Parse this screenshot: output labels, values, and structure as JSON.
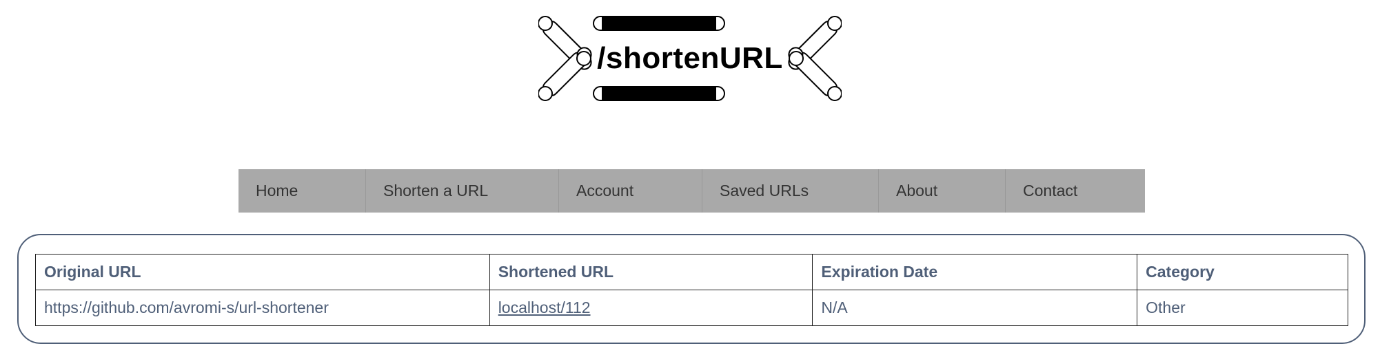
{
  "logo": {
    "text": "/shortenURL"
  },
  "nav": {
    "items": [
      {
        "label": "Home"
      },
      {
        "label": "Shorten a URL"
      },
      {
        "label": "Account"
      },
      {
        "label": "Saved URLs"
      },
      {
        "label": "About"
      },
      {
        "label": "Contact"
      }
    ]
  },
  "table": {
    "headers": [
      "Original URL",
      "Shortened URL",
      "Expiration Date",
      "Category"
    ],
    "rows": [
      {
        "original": "https://github.com/avromi-s/url-shortener",
        "shortened": "localhost/112",
        "expiration": "N/A",
        "category": "Other"
      }
    ]
  },
  "colors": {
    "nav_background": "#a9a9a9",
    "text_accent": "#4f5f78",
    "panel_border": "#4f5f78"
  }
}
